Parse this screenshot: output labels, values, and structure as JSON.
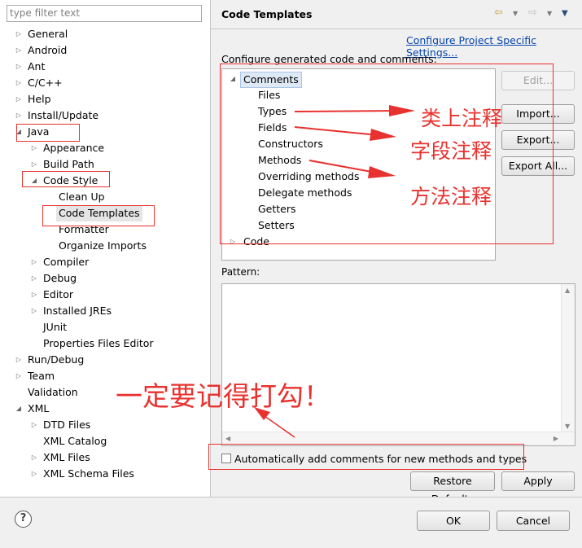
{
  "left": {
    "filter_placeholder": "type filter text",
    "tree": [
      {
        "label": "General",
        "level": 0,
        "toggle": "collapsed"
      },
      {
        "label": "Android",
        "level": 0,
        "toggle": "collapsed"
      },
      {
        "label": "Ant",
        "level": 0,
        "toggle": "collapsed"
      },
      {
        "label": "C/C++",
        "level": 0,
        "toggle": "collapsed"
      },
      {
        "label": "Help",
        "level": 0,
        "toggle": "collapsed"
      },
      {
        "label": "Install/Update",
        "level": 0,
        "toggle": "collapsed"
      },
      {
        "label": "Java",
        "level": 0,
        "toggle": "expanded"
      },
      {
        "label": "Appearance",
        "level": 1,
        "toggle": "collapsed"
      },
      {
        "label": "Build Path",
        "level": 1,
        "toggle": "collapsed"
      },
      {
        "label": "Code Style",
        "level": 1,
        "toggle": "expanded"
      },
      {
        "label": "Clean Up",
        "level": 2,
        "toggle": "none"
      },
      {
        "label": "Code Templates",
        "level": 2,
        "toggle": "none",
        "selected": true
      },
      {
        "label": "Formatter",
        "level": 2,
        "toggle": "none"
      },
      {
        "label": "Organize Imports",
        "level": 2,
        "toggle": "none"
      },
      {
        "label": "Compiler",
        "level": 1,
        "toggle": "collapsed"
      },
      {
        "label": "Debug",
        "level": 1,
        "toggle": "collapsed"
      },
      {
        "label": "Editor",
        "level": 1,
        "toggle": "collapsed"
      },
      {
        "label": "Installed JREs",
        "level": 1,
        "toggle": "collapsed"
      },
      {
        "label": "JUnit",
        "level": 1,
        "toggle": "none"
      },
      {
        "label": "Properties Files Editor",
        "level": 1,
        "toggle": "none"
      },
      {
        "label": "Run/Debug",
        "level": 0,
        "toggle": "collapsed"
      },
      {
        "label": "Team",
        "level": 0,
        "toggle": "collapsed"
      },
      {
        "label": "Validation",
        "level": 0,
        "toggle": "none"
      },
      {
        "label": "XML",
        "level": 0,
        "toggle": "expanded"
      },
      {
        "label": "DTD Files",
        "level": 1,
        "toggle": "collapsed"
      },
      {
        "label": "XML Catalog",
        "level": 1,
        "toggle": "none"
      },
      {
        "label": "XML Files",
        "level": 1,
        "toggle": "collapsed"
      },
      {
        "label": "XML Schema Files",
        "level": 1,
        "toggle": "collapsed"
      }
    ]
  },
  "right": {
    "title": "Code Templates",
    "configure_link": "Configure Project Specific Settings...",
    "configure_label": "Configure generated code and comments:",
    "templates": [
      {
        "label": "Comments",
        "level": 0,
        "toggle": "expanded",
        "selected": true
      },
      {
        "label": "Files",
        "level": 1,
        "toggle": "none"
      },
      {
        "label": "Types",
        "level": 1,
        "toggle": "none"
      },
      {
        "label": "Fields",
        "level": 1,
        "toggle": "none"
      },
      {
        "label": "Constructors",
        "level": 1,
        "toggle": "none"
      },
      {
        "label": "Methods",
        "level": 1,
        "toggle": "none"
      },
      {
        "label": "Overriding methods",
        "level": 1,
        "toggle": "none"
      },
      {
        "label": "Delegate methods",
        "level": 1,
        "toggle": "none"
      },
      {
        "label": "Getters",
        "level": 1,
        "toggle": "none"
      },
      {
        "label": "Setters",
        "level": 1,
        "toggle": "none"
      },
      {
        "label": "Code",
        "level": 0,
        "toggle": "collapsed"
      }
    ],
    "buttons": {
      "edit": "Edit...",
      "import": "Import...",
      "export": "Export...",
      "export_all": "Export All..."
    },
    "pattern_label": "Pattern:",
    "auto_comment_label": "Automatically add comments for new methods and types",
    "auto_comment_checked": false,
    "restore_defaults": "Restore Defaults",
    "apply": "Apply"
  },
  "footer": {
    "help_glyph": "?",
    "ok": "OK",
    "cancel": "Cancel"
  },
  "annotations": {
    "types_note": "类上注释",
    "fields_note": "字段注释",
    "methods_note": "方法注释",
    "checkbox_note": "一定要记得打勾！",
    "color": "#e8322f"
  },
  "icons": {
    "back": "back-arrow-icon",
    "forward": "forward-arrow-icon",
    "menu": "view-menu-icon",
    "help": "help-icon"
  }
}
